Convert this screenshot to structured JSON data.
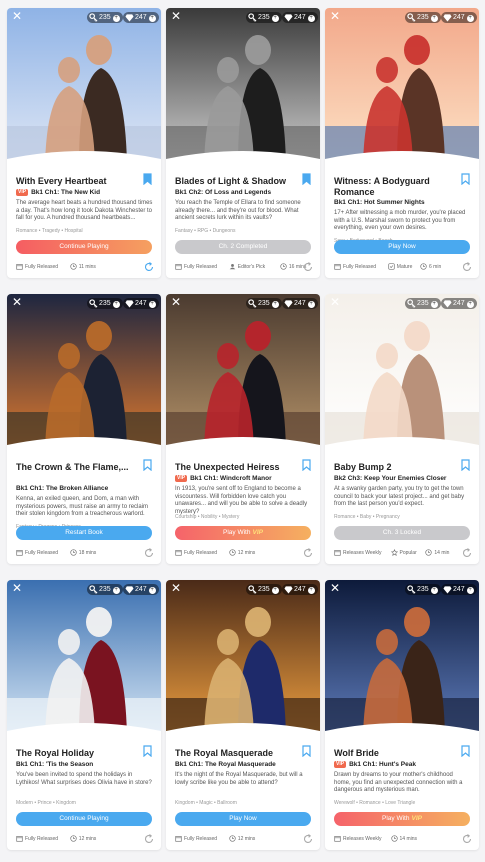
{
  "currency": {
    "keys": "235",
    "gems": "247"
  },
  "colors": {
    "primary_blue": "#4aa9ef",
    "locked_grey": "#c9c9cc",
    "vip_orange": "#f5636a",
    "vip_yellow": "#ffe07a"
  },
  "cards": [
    {
      "title": "With Every Heartbeat",
      "vip": true,
      "chapter": "Bk1 Ch1: The New Kid",
      "description": "The average heart beats a hundred thousand times a day. That's how long it took Dakota Winchester to fall for you. A hundred thousand heartbeats...",
      "tags": "Romance • Tragedy • Hospital",
      "button": "Continue Playing",
      "button_style": "orange",
      "bookmarked": true,
      "footer": [
        {
          "icon": "calendar-icon",
          "text": "Fully Released"
        },
        {
          "icon": "clock-icon",
          "text": "11 mins"
        }
      ],
      "refresh_icon": "refresh-icon-blue"
    },
    {
      "title": "Blades of Light & Shadow",
      "vip": false,
      "chapter": "Bk1 Ch2: Of Loss and Legends",
      "description": "You reach the Temple of Ellara to find someone already there... and they're out for blood. What ancient secrets lurk within its vaults?",
      "tags": "Fantasy • RPG • Dungeons",
      "button": "Ch. 2 Completed",
      "button_style": "grey",
      "bookmarked": true,
      "footer": [
        {
          "icon": "calendar-icon",
          "text": "Fully Released"
        },
        {
          "icon": "editors-pick-icon",
          "text": "Editor's Pick"
        },
        {
          "icon": "clock-icon",
          "text": "16 mins"
        }
      ],
      "refresh_icon": "refresh-icon-grey"
    },
    {
      "title": "Witness: A Bodyguard Romance",
      "vip": false,
      "chapter": "Bk1 Ch1: Hot Summer Nights",
      "description": "17+ After witnessing a mob murder, you're placed with a U.S. Marshal sworn to protect you from everything, even your own desires.",
      "tags": "Sexy • Bodyguard • Beach",
      "button": "Play Now",
      "button_style": "blue",
      "bookmarked": false,
      "footer": [
        {
          "icon": "calendar-icon",
          "text": "Fully Released"
        },
        {
          "icon": "mature-icon",
          "text": "Mature"
        },
        {
          "icon": "clock-icon",
          "text": "6 min"
        }
      ],
      "refresh_icon": "refresh-icon-grey"
    },
    {
      "title": "The Crown & The Flame,...",
      "vip": false,
      "chapter": "Bk1 Ch1: The Broken Alliance",
      "description": "Kenna, an exiled queen, and Dom, a man with mysterious powers, must raise an army to reclaim their stolen kingdom from a treacherous warlord.",
      "tags": "Fantasy • Dragons • Princess",
      "button": "Restart Book",
      "button_style": "blue",
      "bookmarked": false,
      "footer": [
        {
          "icon": "calendar-icon",
          "text": "Fully Released"
        },
        {
          "icon": "clock-icon",
          "text": "18 mins"
        }
      ],
      "refresh_icon": "refresh-icon-grey"
    },
    {
      "title": "The Unexpected Heiress",
      "vip": true,
      "chapter": "Bk1 Ch1: Windcroft Manor",
      "description": "In 1913, you're sent off to England to become a viscountess. Will forbidden love catch you unawares... and will you be able to solve a deadly mystery?",
      "tags": "Courtship • Nobility • Mystery",
      "button": "Play With",
      "button_vip": "VIP",
      "button_style": "vip",
      "bookmarked": false,
      "footer": [
        {
          "icon": "calendar-icon",
          "text": "Fully Released"
        },
        {
          "icon": "clock-icon",
          "text": "12 mins"
        }
      ],
      "refresh_icon": "refresh-icon-grey"
    },
    {
      "title": "Baby Bump 2",
      "vip": false,
      "chapter": "Bk2 Ch3: Keep Your Enemies Closer",
      "description": "At a swanky garden party, you try to get the town council to back your latest project... and get baby from the last person you'd expect.",
      "tags": "Romance • Baby • Pregnancy",
      "button": "Ch. 3 Locked",
      "button_style": "grey",
      "bookmarked": false,
      "footer": [
        {
          "icon": "calendar-icon",
          "text": "Releases Weekly"
        },
        {
          "icon": "popular-icon",
          "text": "Popular"
        },
        {
          "icon": "clock-icon",
          "text": "14 min"
        }
      ],
      "refresh_icon": "refresh-icon-grey"
    },
    {
      "title": "The Royal Holiday",
      "vip": false,
      "chapter": "Bk1 Ch1: 'Tis the Season",
      "description": "You've been invited to spend the holidays in Lythikos! What surprises does Olivia have in store?",
      "tags": "Modern • Prince • Kingdom",
      "button": "Continue Playing",
      "button_style": "blue",
      "bookmarked": false,
      "footer": [
        {
          "icon": "calendar-icon",
          "text": "Fully Released"
        },
        {
          "icon": "clock-icon",
          "text": "12 mins"
        }
      ],
      "refresh_icon": "refresh-icon-grey"
    },
    {
      "title": "The Royal Masquerade",
      "vip": false,
      "chapter": "Bk1 Ch1: The Royal Masquerade",
      "description": "It's the night of the Royal Masquerade, but will a lowly scribe like you be able to attend?",
      "tags": "Kingdom • Magic • Ballroom",
      "button": "Play Now",
      "button_style": "blue",
      "bookmarked": false,
      "footer": [
        {
          "icon": "calendar-icon",
          "text": "Fully Released"
        },
        {
          "icon": "clock-icon",
          "text": "12 mins"
        }
      ],
      "refresh_icon": "refresh-icon-grey"
    },
    {
      "title": "Wolf Bride",
      "vip": true,
      "chapter": "Bk1 Ch1: Hunt's Peak",
      "description": "Drawn by dreams to your mother's childhood home, you find an unexpected connection with a dangerous and mysterious man.",
      "tags": "Werewolf • Romance • Love Triangle",
      "button": "Play With",
      "button_vip": "VIP",
      "button_style": "vip",
      "bookmarked": false,
      "footer": [
        {
          "icon": "calendar-icon",
          "text": "Releases Weekly"
        },
        {
          "icon": "clock-icon",
          "text": "14 mins"
        }
      ],
      "refresh_icon": "refresh-icon-grey"
    }
  ]
}
